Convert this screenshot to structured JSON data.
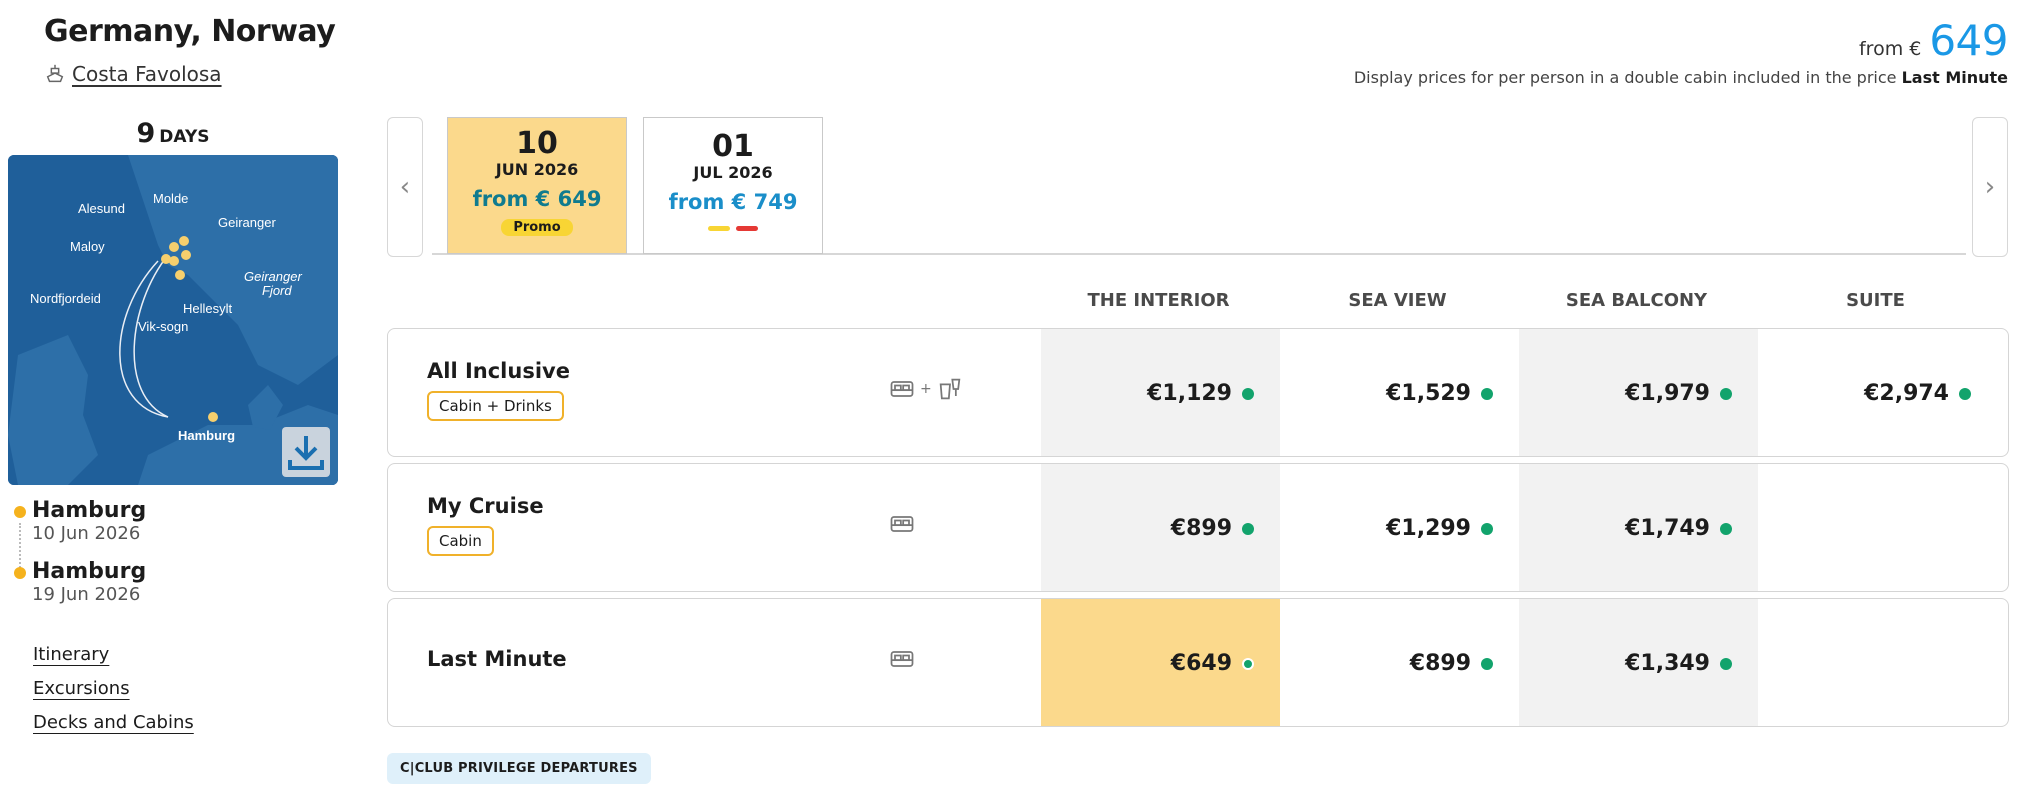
{
  "header": {
    "title": "Germany, Norway",
    "ship_name": "Costa Favolosa",
    "from_label": "from €",
    "from_price": "649",
    "display_note_prefix": "Display prices for per person in a double cabin included in the price",
    "display_note_bold": "Last Minute"
  },
  "sidebar": {
    "days_number": "9",
    "days_label": "DAYS",
    "map_labels": [
      "Molde",
      "Alesund",
      "Geiranger",
      "Maloy",
      "Geiranger",
      "Fjord",
      "Nordfjordeid",
      "Hellesylt",
      "Vik-sogn",
      "Hamburg"
    ],
    "ports": [
      {
        "name": "Hamburg",
        "date": "10 Jun 2026"
      },
      {
        "name": "Hamburg",
        "date": "19 Jun 2026"
      }
    ],
    "links": [
      "Itinerary",
      "Excursions",
      "Decks and Cabins"
    ]
  },
  "dates": [
    {
      "day": "10",
      "month": "JUN 2026",
      "price": "from € 649",
      "badge": "Promo",
      "active": true
    },
    {
      "day": "01",
      "month": "JUL 2026",
      "price": "from € 749",
      "active": false
    }
  ],
  "flag_colors": [
    "#f8d534",
    "#e53935"
  ],
  "cabin_columns": [
    "THE INTERIOR",
    "SEA VIEW",
    "SEA BALCONY",
    "SUITE"
  ],
  "packages": [
    {
      "name": "All Inclusive",
      "tag": "Cabin + Drinks",
      "prices": [
        "€1,129",
        "€1,529",
        "€1,979",
        "€2,974"
      ]
    },
    {
      "name": "My Cruise",
      "tag": "Cabin",
      "prices": [
        "€899",
        "€1,299",
        "€1,749",
        ""
      ]
    },
    {
      "name": "Last Minute",
      "tag": "",
      "prices": [
        "€649",
        "€899",
        "€1,349",
        ""
      ]
    }
  ],
  "cclub_label": "C|CLUB PRIVILEGE DEPARTURES",
  "colors": {
    "accent_blue": "#1a98e6",
    "highlight_yellow": "#fbd98c",
    "available_green": "#12a36c",
    "tag_border": "#f0b12a"
  }
}
